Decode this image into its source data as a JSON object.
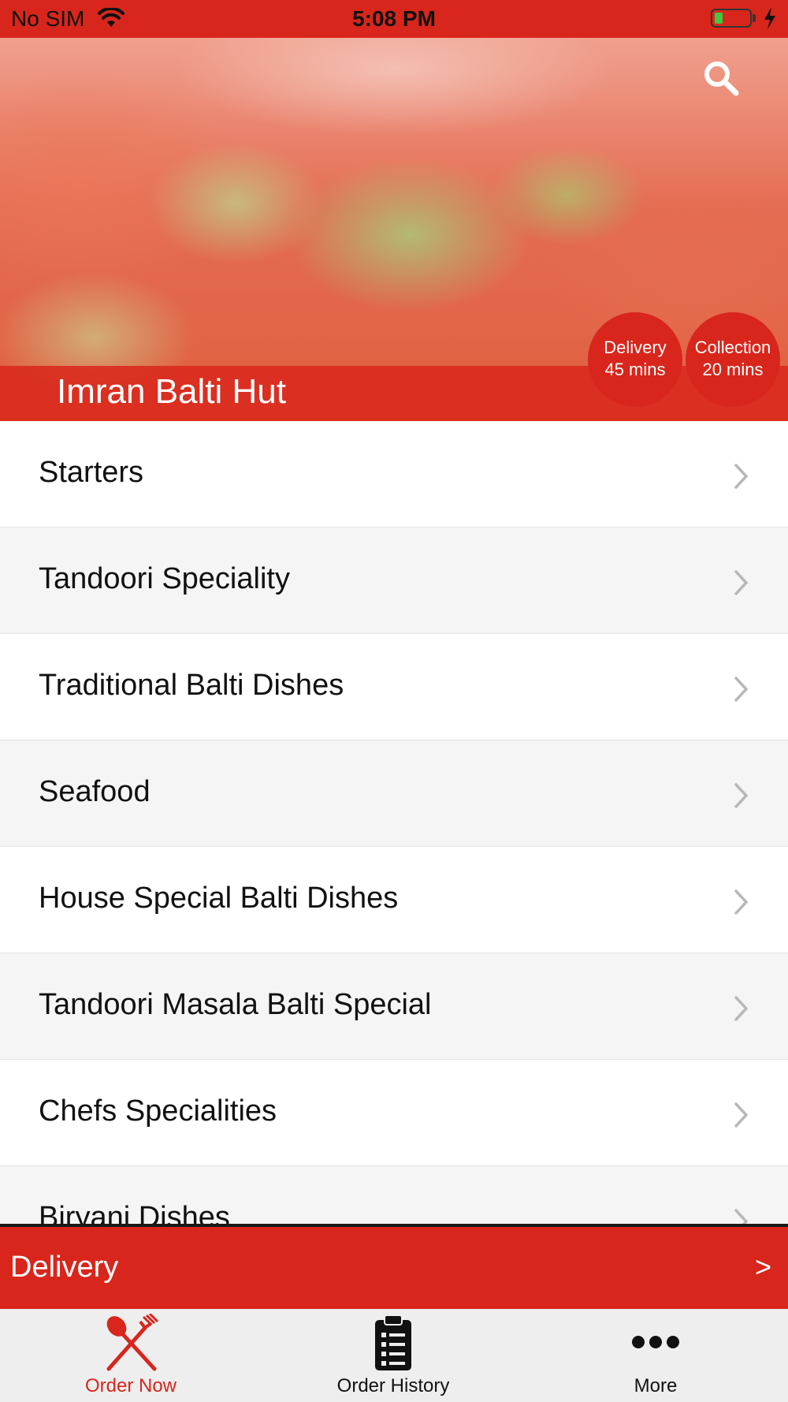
{
  "status_bar": {
    "carrier": "No SIM",
    "time": "5:08 PM"
  },
  "hero": {
    "restaurant_name": "Imran Balti Hut",
    "badges": {
      "delivery": {
        "label": "Delivery",
        "time": "45 mins"
      },
      "collection": {
        "label": "Collection",
        "time": "20 mins"
      }
    }
  },
  "menu": {
    "categories": [
      "Starters",
      "Tandoori Speciality",
      "Traditional Balti Dishes",
      "Seafood",
      "House Special Balti Dishes",
      "Tandoori Masala Balti Special",
      "Chefs Specialities",
      "Biryani Dishes"
    ]
  },
  "order_type_bar": {
    "label": "Delivery",
    "arrow": ">"
  },
  "tab_bar": {
    "order_now": "Order Now",
    "order_history": "Order History",
    "more": "More"
  },
  "colors": {
    "brand_red": "#d8261c",
    "row_alt": "#f5f5f5",
    "tab_bar_bg": "#eeeeee"
  }
}
